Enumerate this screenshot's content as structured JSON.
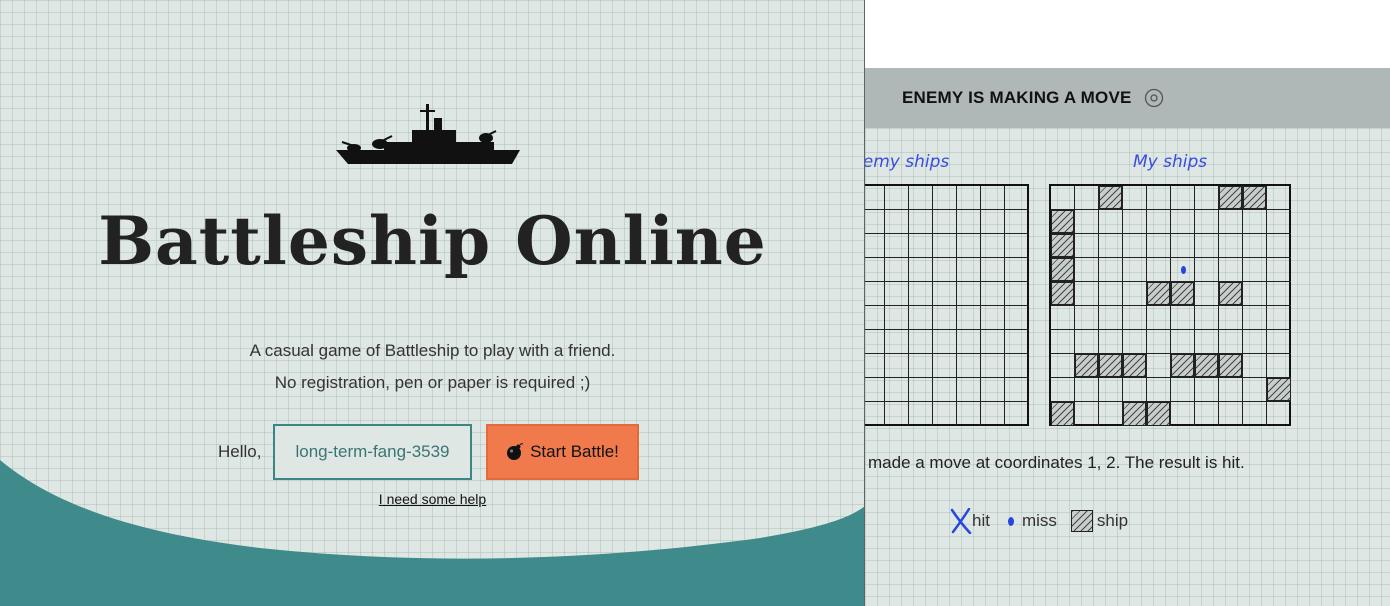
{
  "landing": {
    "title": "Battleship Online",
    "tagline_1": "A casual game of Battleship to play with a friend.",
    "tagline_2": "No registration, pen or paper is required ;)",
    "hello_label": "Hello,",
    "name_value": "long-term-fang-3539",
    "start_button_label": "Start Battle!",
    "help_link": "I need some help",
    "logo_icon": "battleship-silhouette-icon",
    "start_icon": "bomb-icon",
    "colors": {
      "accent_teal": "#3b8584",
      "button_orange": "#f07a4b",
      "paper": "#dfe7e4"
    }
  },
  "game": {
    "status": "ENEMY IS MAKING A MOVE",
    "status_icon": "spinner-icon",
    "enemy_board_label": "nemy ships",
    "my_board_label": "My ships",
    "move_message": "made a move at coordinates 1, 2. The result is hit.",
    "board_size": 10,
    "my_ships": [
      [
        0,
        2
      ],
      [
        0,
        7
      ],
      [
        0,
        8
      ],
      [
        1,
        0
      ],
      [
        2,
        0
      ],
      [
        3,
        0
      ],
      [
        4,
        0
      ],
      [
        4,
        4
      ],
      [
        4,
        5
      ],
      [
        4,
        7
      ],
      [
        7,
        1
      ],
      [
        7,
        2
      ],
      [
        7,
        3
      ],
      [
        7,
        5
      ],
      [
        7,
        6
      ],
      [
        7,
        7
      ],
      [
        8,
        9
      ],
      [
        9,
        0
      ],
      [
        9,
        3
      ],
      [
        9,
        4
      ]
    ],
    "my_misses": [
      [
        3,
        5
      ]
    ],
    "legend": {
      "hit": "hit",
      "miss": "miss",
      "ship": "ship"
    },
    "colors": {
      "marker_blue": "#2746e0",
      "status_bar": "#b0b8b7"
    }
  }
}
